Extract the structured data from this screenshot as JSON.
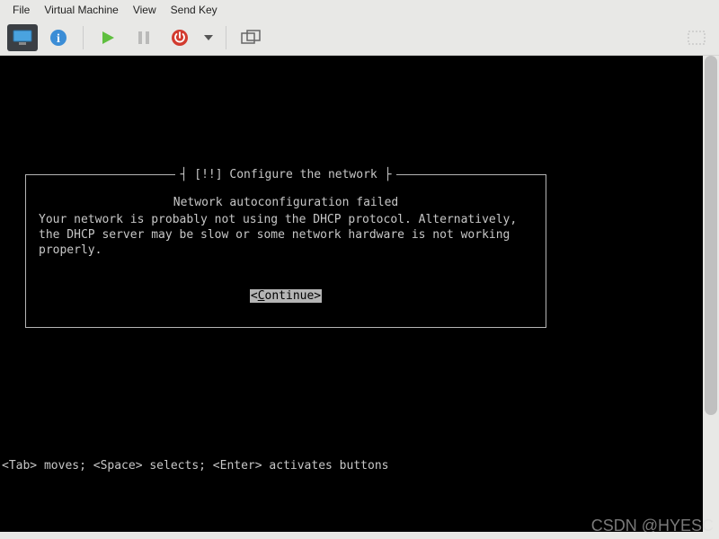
{
  "menubar": {
    "file": "File",
    "vm": "Virtual Machine",
    "view": "View",
    "sendkey": "Send Key"
  },
  "dialog": {
    "title": "[!!] Configure the network",
    "heading": "Network autoconfiguration failed",
    "body": "Your network is probably not using the DHCP protocol. Alternatively, the DHCP server may be slow or some network hardware is not working properly.",
    "continue_prefix": "<",
    "continue_hot": "C",
    "continue_rest": "ontinue>"
  },
  "hint": "<Tab> moves; <Space> selects; <Enter> activates buttons",
  "watermark": "CSDN @HYESC"
}
